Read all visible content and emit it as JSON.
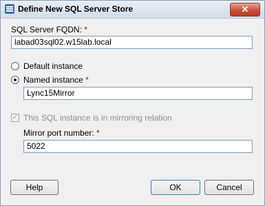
{
  "window": {
    "title": "Define New SQL Server Store",
    "close_glyph": "✕"
  },
  "fqdn": {
    "label": "SQL Server FQDN:",
    "required_mark": "*",
    "value": "labad03sql02.w15lab.local"
  },
  "instance": {
    "default_label": "Default instance",
    "named_label": "Named instance",
    "named_required_mark": "*",
    "named_value": "Lync15Mirror",
    "selected": "named"
  },
  "mirroring": {
    "checkbox_label": "This SQL instance is in mirroring relation",
    "checked": true,
    "enabled": false,
    "port_label": "Mirror port number:",
    "port_required_mark": "*",
    "port_value": "5022"
  },
  "buttons": {
    "help": "Help",
    "ok": "OK",
    "cancel": "Cancel"
  },
  "colors": {
    "required": "#d40000",
    "disabled_text": "#8c8c8c"
  }
}
